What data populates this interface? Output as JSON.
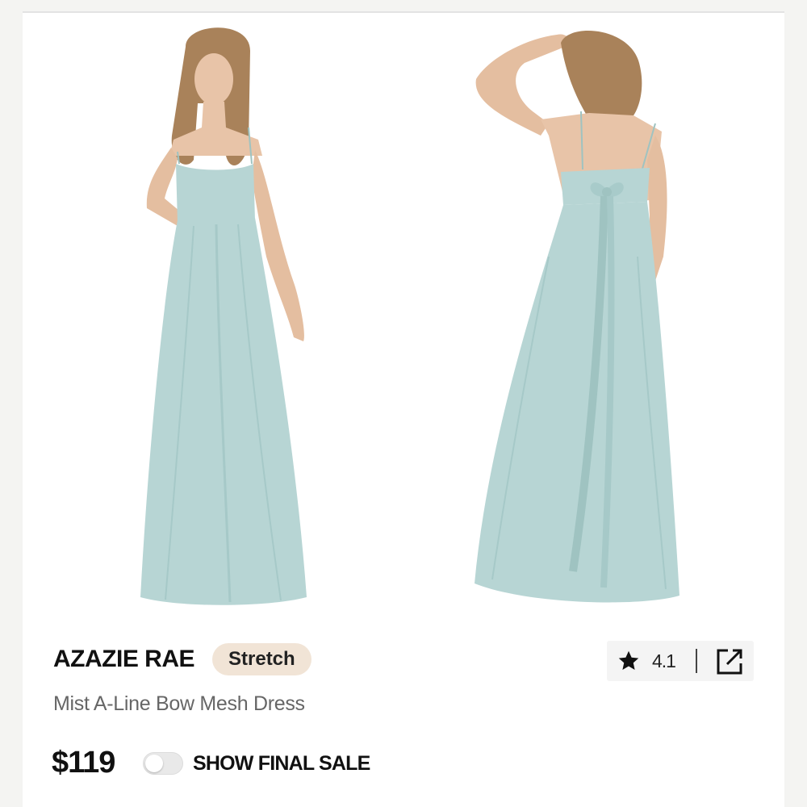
{
  "product": {
    "brand": "AZAZIE RAE",
    "badge": "Stretch",
    "name": "Mist A-Line Bow Mesh Dress",
    "price": "$119",
    "dress_color": "#b7d5d4",
    "images": [
      {
        "view": "front"
      },
      {
        "view": "back"
      }
    ]
  },
  "rating": {
    "value": "4.1",
    "icon": "star-icon",
    "share_icon": "external-link-icon"
  },
  "final_sale": {
    "label": "SHOW FINAL SALE",
    "enabled": false
  },
  "colors": {
    "badge_bg": "#f1e4d6",
    "text": "#111111",
    "subtitle": "#666666"
  }
}
